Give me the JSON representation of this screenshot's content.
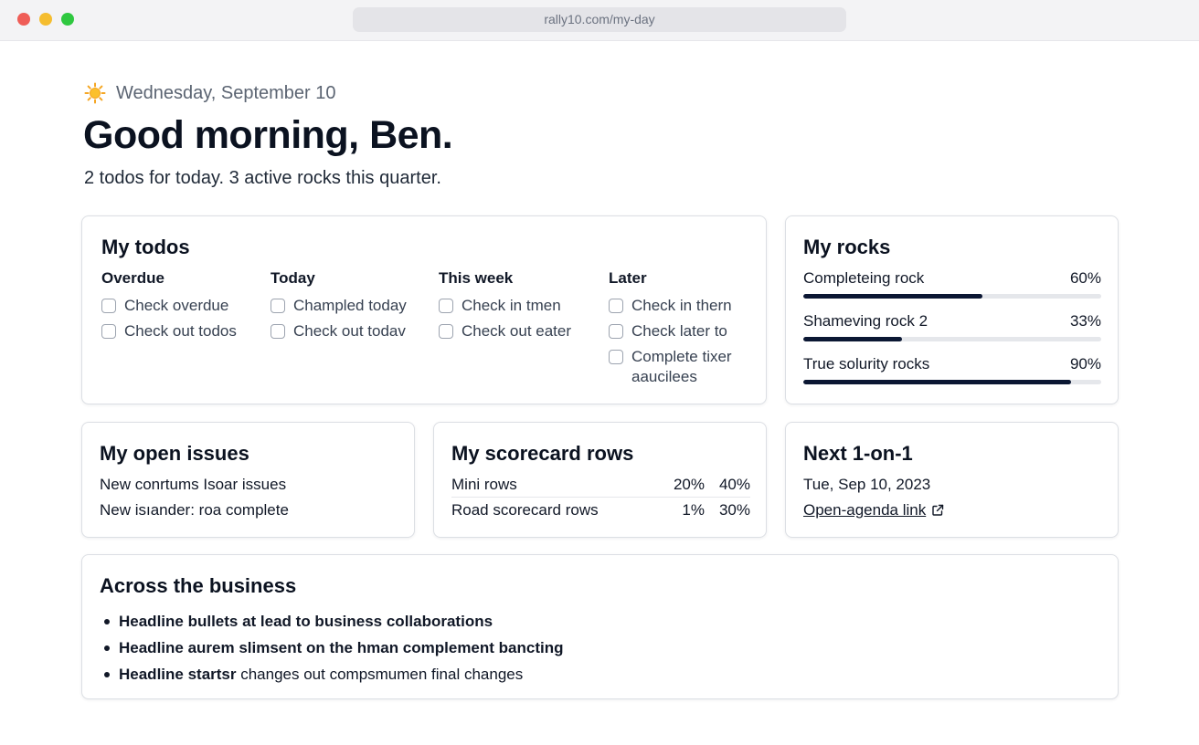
{
  "browser": {
    "url": "rally10.com/my-day"
  },
  "header": {
    "date": "Wednesday, September 10",
    "greeting": "Good morning, Ben.",
    "summary": "2 todos for today. 3 active rocks this quarter."
  },
  "todos": {
    "title": "My todos",
    "columns": [
      {
        "heading": "Overdue",
        "items": [
          "Check overdue",
          "Check out todos"
        ]
      },
      {
        "heading": "Today",
        "items": [
          "Champled today",
          "Check out todav"
        ]
      },
      {
        "heading": "This week",
        "items": [
          "Check in tmen",
          "Check out eater"
        ]
      },
      {
        "heading": "Later",
        "items": [
          "Check in thern",
          "Check later to",
          "Complete tixer aaucilees"
        ]
      }
    ]
  },
  "rocks": {
    "title": "My rocks",
    "items": [
      {
        "name": "Completeing rock",
        "percent_label": "60%",
        "progress": 0.6
      },
      {
        "name": "Shameving rock 2",
        "percent_label": "33%",
        "progress": 0.33
      },
      {
        "name": "True solurity rocks",
        "percent_label": "90%",
        "progress": 0.9
      }
    ],
    "bar_color": "#0b1733"
  },
  "issues": {
    "title": "My open issues",
    "items": [
      "New conrtums Isoar issues",
      "New isıander: roa complete"
    ]
  },
  "scorecard": {
    "title": "My scorecard rows",
    "rows": [
      {
        "name": "Mini rows",
        "a": "20%",
        "b": "40%"
      },
      {
        "name": "Road scorecard rows",
        "a": "1%",
        "b": "30%"
      }
    ]
  },
  "one_on_one": {
    "title": "Next 1-on-1",
    "date": "Tue, Sep 10, 2023",
    "link": "Open-agenda link",
    "link_icon": "external-link-icon"
  },
  "business": {
    "title": "Across the business",
    "items": [
      {
        "bold": "Headline bullets at lead to business collaborations",
        "rest": ""
      },
      {
        "bold": "Headline aurem slimsent on the hman complement bancting",
        "rest": ""
      },
      {
        "bold": "Headline startsr",
        "rest": " changes out compsmumen final changes"
      }
    ]
  },
  "icons": {
    "date": "sun-icon"
  },
  "colors": {
    "accent": "#0b1733",
    "window_red": "#ef5d57",
    "window_yellow": "#f5bd2f",
    "window_green": "#2fc840"
  }
}
